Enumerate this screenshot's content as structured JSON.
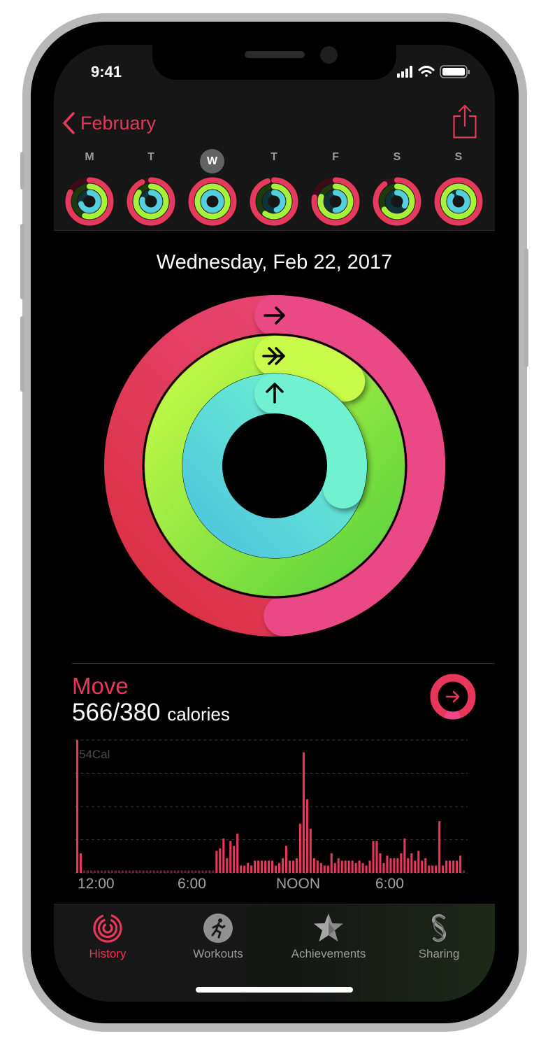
{
  "status_bar": {
    "time": "9:41"
  },
  "nav": {
    "back_label": "February"
  },
  "week": {
    "days": [
      {
        "letter": "M",
        "selected": false,
        "move": 0.82,
        "exercise": 0.55,
        "stand": 0.7
      },
      {
        "letter": "T",
        "selected": false,
        "move": 0.93,
        "exercise": 0.85,
        "stand": 0.78
      },
      {
        "letter": "W",
        "selected": true,
        "move": 1.0,
        "exercise": 1.0,
        "stand": 1.0
      },
      {
        "letter": "T",
        "selected": false,
        "move": 0.95,
        "exercise": 0.6,
        "stand": 0.45
      },
      {
        "letter": "F",
        "selected": false,
        "move": 0.78,
        "exercise": 0.8,
        "stand": 0.5
      },
      {
        "letter": "S",
        "selected": false,
        "move": 0.9,
        "exercise": 0.66,
        "stand": 0.33
      },
      {
        "letter": "S",
        "selected": false,
        "move": 1.0,
        "exercise": 1.0,
        "stand": 0.85
      }
    ]
  },
  "summary": {
    "date": "Wednesday, Feb 22, 2017",
    "rings": {
      "move": 1.49,
      "exercise": 1.11,
      "stand": 1.3
    }
  },
  "move": {
    "title": "Move",
    "value": "566/380",
    "unit": "calories",
    "max_label": "54Cal",
    "axis": [
      "12:00",
      "6:00",
      "NOON",
      "6:00"
    ]
  },
  "chart_data": {
    "type": "bar",
    "ylabel": "54Cal",
    "x_ticks": [
      "12:00",
      "6:00",
      "NOON",
      "6:00"
    ],
    "ylim": [
      0,
      54
    ],
    "values": [
      54,
      8,
      1,
      1,
      1,
      1,
      1,
      1,
      1,
      1,
      1,
      1,
      1,
      1,
      1,
      1,
      1,
      1,
      1,
      1,
      1,
      1,
      1,
      1,
      1,
      1,
      1,
      1,
      1,
      1,
      1,
      1,
      1,
      1,
      1,
      1,
      1,
      1,
      1,
      1,
      9,
      10,
      14,
      6,
      13,
      11,
      16,
      3,
      3,
      4,
      3,
      5,
      5,
      5,
      5,
      5,
      5,
      3,
      4,
      6,
      11,
      5,
      5,
      6,
      20,
      49,
      30,
      18,
      6,
      5,
      4,
      3,
      3,
      8,
      4,
      6,
      5,
      5,
      5,
      5,
      4,
      5,
      4,
      3,
      5,
      13,
      13,
      8,
      4,
      7,
      6,
      6,
      6,
      8,
      14,
      6,
      8,
      5,
      9,
      5,
      6,
      3,
      3,
      3,
      21,
      3,
      5,
      5,
      5,
      5,
      7,
      1
    ]
  },
  "tabs": [
    {
      "label": "History",
      "icon": "history-icon",
      "active": true
    },
    {
      "label": "Workouts",
      "icon": "running-figure-icon",
      "active": false
    },
    {
      "label": "Achievements",
      "icon": "star-badge-icon",
      "active": false
    },
    {
      "label": "Sharing",
      "icon": "sharing-icon",
      "active": false
    }
  ],
  "colors": {
    "move": "#e63a5d",
    "move_end": "#ee4f8a",
    "exercise": "#a6f23a",
    "exercise_dark": "#64d43c",
    "stand": "#55cfe0",
    "stand_end": "#6ef2cf",
    "accent": "#e8375a"
  }
}
